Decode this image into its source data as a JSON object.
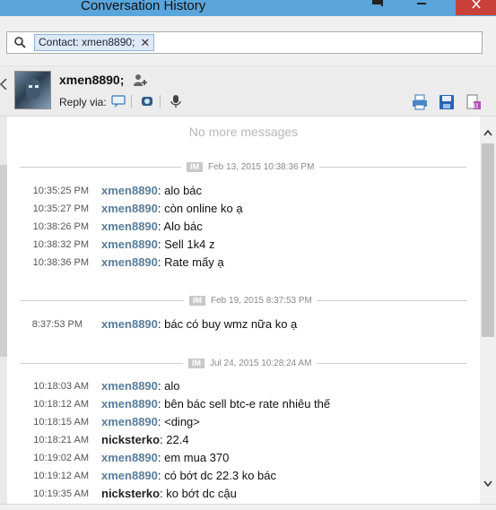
{
  "window": {
    "title": "Conversation History",
    "colors": {
      "titlebar": "#5aa5dc",
      "close": "#c9403a",
      "contact_name": "#5a7d9a"
    }
  },
  "search": {
    "chip_label": "Contact: xmen8890;",
    "chip_remove": "✕",
    "value": ""
  },
  "contact": {
    "name": "xmen8890;",
    "reply_via_label": "Reply via:"
  },
  "messages_area": {
    "no_more_label": "No more messages",
    "dividers": [
      {
        "tag": "IM",
        "datetime": "Feb 13, 2015 10:38:36 PM"
      },
      {
        "tag": "IM",
        "datetime": "Feb 19, 2015 8:37:53 PM"
      },
      {
        "tag": "IM",
        "datetime": "Jul 24, 2015 10:28:24 AM"
      }
    ],
    "messages": [
      {
        "time": "10:35:25 PM",
        "sender": "xmen8890",
        "text": ": alo bác"
      },
      {
        "time": "10:35:27 PM",
        "sender": "xmen8890",
        "text": ": còn online ko ạ"
      },
      {
        "time": "10:38:26 PM",
        "sender": "xmen8890",
        "text": ": Alo bác"
      },
      {
        "time": "10:38:32 PM",
        "sender": "xmen8890",
        "text": ": Sell 1k4 z"
      },
      {
        "time": "10:38:36 PM",
        "sender": "xmen8890",
        "text": ": Rate mấy ạ"
      },
      {
        "time": "8:37:53 PM",
        "sender": "xmen8890",
        "text": ": bác có buy wmz nữa ko ạ"
      },
      {
        "time": "10:18:03 AM",
        "sender": "xmen8890",
        "text": ": alo"
      },
      {
        "time": "10:18:12 AM",
        "sender": "xmen8890",
        "text": ": bên bác sell btc-e rate nhiêu thế"
      },
      {
        "time": "10:18:15 AM",
        "sender": "xmen8890",
        "text": ": <ding>"
      },
      {
        "time": "10:18:21 AM",
        "sender": "nicksterko",
        "text": ": 22.4"
      },
      {
        "time": "10:19:02 AM",
        "sender": "xmen8890",
        "text": ": em mua 370"
      },
      {
        "time": "10:19:12 AM",
        "sender": "xmen8890",
        "text": ": có bớt dc 22.3 ko bác"
      },
      {
        "time": "10:19:35 AM",
        "sender": "nicksterko",
        "text": ": ko bớt dc cậu"
      }
    ]
  }
}
